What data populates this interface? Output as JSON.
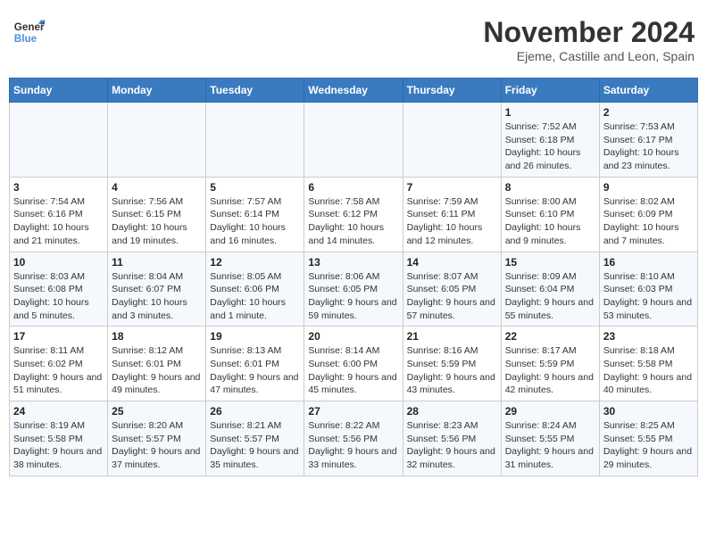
{
  "header": {
    "logo_general": "General",
    "logo_blue": "Blue",
    "month_title": "November 2024",
    "location": "Ejeme, Castille and Leon, Spain"
  },
  "weekdays": [
    "Sunday",
    "Monday",
    "Tuesday",
    "Wednesday",
    "Thursday",
    "Friday",
    "Saturday"
  ],
  "weeks": [
    [
      {
        "day": "",
        "info": ""
      },
      {
        "day": "",
        "info": ""
      },
      {
        "day": "",
        "info": ""
      },
      {
        "day": "",
        "info": ""
      },
      {
        "day": "",
        "info": ""
      },
      {
        "day": "1",
        "info": "Sunrise: 7:52 AM\nSunset: 6:18 PM\nDaylight: 10 hours and 26 minutes."
      },
      {
        "day": "2",
        "info": "Sunrise: 7:53 AM\nSunset: 6:17 PM\nDaylight: 10 hours and 23 minutes."
      }
    ],
    [
      {
        "day": "3",
        "info": "Sunrise: 7:54 AM\nSunset: 6:16 PM\nDaylight: 10 hours and 21 minutes."
      },
      {
        "day": "4",
        "info": "Sunrise: 7:56 AM\nSunset: 6:15 PM\nDaylight: 10 hours and 19 minutes."
      },
      {
        "day": "5",
        "info": "Sunrise: 7:57 AM\nSunset: 6:14 PM\nDaylight: 10 hours and 16 minutes."
      },
      {
        "day": "6",
        "info": "Sunrise: 7:58 AM\nSunset: 6:12 PM\nDaylight: 10 hours and 14 minutes."
      },
      {
        "day": "7",
        "info": "Sunrise: 7:59 AM\nSunset: 6:11 PM\nDaylight: 10 hours and 12 minutes."
      },
      {
        "day": "8",
        "info": "Sunrise: 8:00 AM\nSunset: 6:10 PM\nDaylight: 10 hours and 9 minutes."
      },
      {
        "day": "9",
        "info": "Sunrise: 8:02 AM\nSunset: 6:09 PM\nDaylight: 10 hours and 7 minutes."
      }
    ],
    [
      {
        "day": "10",
        "info": "Sunrise: 8:03 AM\nSunset: 6:08 PM\nDaylight: 10 hours and 5 minutes."
      },
      {
        "day": "11",
        "info": "Sunrise: 8:04 AM\nSunset: 6:07 PM\nDaylight: 10 hours and 3 minutes."
      },
      {
        "day": "12",
        "info": "Sunrise: 8:05 AM\nSunset: 6:06 PM\nDaylight: 10 hours and 1 minute."
      },
      {
        "day": "13",
        "info": "Sunrise: 8:06 AM\nSunset: 6:05 PM\nDaylight: 9 hours and 59 minutes."
      },
      {
        "day": "14",
        "info": "Sunrise: 8:07 AM\nSunset: 6:05 PM\nDaylight: 9 hours and 57 minutes."
      },
      {
        "day": "15",
        "info": "Sunrise: 8:09 AM\nSunset: 6:04 PM\nDaylight: 9 hours and 55 minutes."
      },
      {
        "day": "16",
        "info": "Sunrise: 8:10 AM\nSunset: 6:03 PM\nDaylight: 9 hours and 53 minutes."
      }
    ],
    [
      {
        "day": "17",
        "info": "Sunrise: 8:11 AM\nSunset: 6:02 PM\nDaylight: 9 hours and 51 minutes."
      },
      {
        "day": "18",
        "info": "Sunrise: 8:12 AM\nSunset: 6:01 PM\nDaylight: 9 hours and 49 minutes."
      },
      {
        "day": "19",
        "info": "Sunrise: 8:13 AM\nSunset: 6:01 PM\nDaylight: 9 hours and 47 minutes."
      },
      {
        "day": "20",
        "info": "Sunrise: 8:14 AM\nSunset: 6:00 PM\nDaylight: 9 hours and 45 minutes."
      },
      {
        "day": "21",
        "info": "Sunrise: 8:16 AM\nSunset: 5:59 PM\nDaylight: 9 hours and 43 minutes."
      },
      {
        "day": "22",
        "info": "Sunrise: 8:17 AM\nSunset: 5:59 PM\nDaylight: 9 hours and 42 minutes."
      },
      {
        "day": "23",
        "info": "Sunrise: 8:18 AM\nSunset: 5:58 PM\nDaylight: 9 hours and 40 minutes."
      }
    ],
    [
      {
        "day": "24",
        "info": "Sunrise: 8:19 AM\nSunset: 5:58 PM\nDaylight: 9 hours and 38 minutes."
      },
      {
        "day": "25",
        "info": "Sunrise: 8:20 AM\nSunset: 5:57 PM\nDaylight: 9 hours and 37 minutes."
      },
      {
        "day": "26",
        "info": "Sunrise: 8:21 AM\nSunset: 5:57 PM\nDaylight: 9 hours and 35 minutes."
      },
      {
        "day": "27",
        "info": "Sunrise: 8:22 AM\nSunset: 5:56 PM\nDaylight: 9 hours and 33 minutes."
      },
      {
        "day": "28",
        "info": "Sunrise: 8:23 AM\nSunset: 5:56 PM\nDaylight: 9 hours and 32 minutes."
      },
      {
        "day": "29",
        "info": "Sunrise: 8:24 AM\nSunset: 5:55 PM\nDaylight: 9 hours and 31 minutes."
      },
      {
        "day": "30",
        "info": "Sunrise: 8:25 AM\nSunset: 5:55 PM\nDaylight: 9 hours and 29 minutes."
      }
    ]
  ]
}
